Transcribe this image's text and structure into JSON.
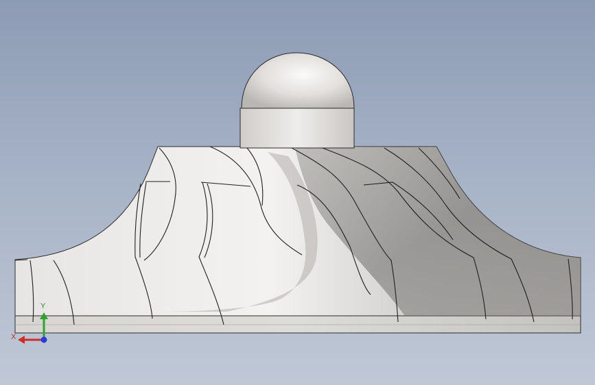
{
  "viewport": {
    "background_top": "#8c9bb4",
    "background_bottom": "#c0c8d6",
    "model": {
      "type": "impeller",
      "parts": [
        "dome-cap",
        "hub-neck",
        "blades",
        "backplate"
      ]
    },
    "triad": {
      "x_label": "X",
      "y_label": "Y",
      "x_color": "#d42a2a",
      "y_color": "#2ea32e",
      "z_color": "#2a3ad4"
    }
  }
}
